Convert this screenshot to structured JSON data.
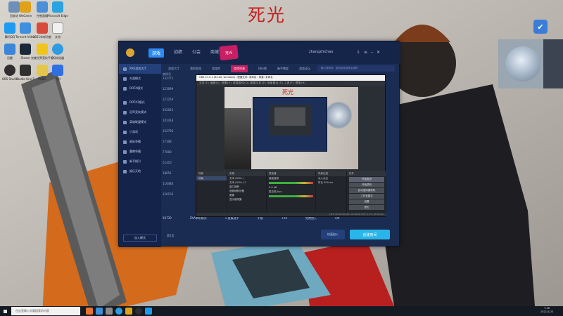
{
  "title": "死光",
  "desktop_icons": [
    {
      "label": "回收站",
      "color": "#6e8fb8"
    },
    {
      "label": "WeGame",
      "color": "#e0a11b"
    },
    {
      "label": "控制面板",
      "color": "#4a90d9"
    },
    {
      "label": "Microsoft Edge",
      "color": "#2aa3e0"
    },
    {
      "label": "腾讯QQ",
      "color": "#1e9bf0"
    },
    {
      "label": "Tencent Video",
      "color": "#3f8fe0"
    },
    {
      "label": "2021年新功能",
      "color": "#d94a3a"
    },
    {
      "label": "文档",
      "color": "#f0f0f0"
    },
    {
      "label": "迅雷",
      "color": "#3a86d8"
    },
    {
      "label": "Steam",
      "color": "#1b2838"
    },
    {
      "label": "完美世界竞技平台",
      "color": "#f0c419"
    },
    {
      "label": "QQ浏览器",
      "color": "#2f9be0"
    },
    {
      "label": "OBS Studio",
      "color": "#302e31"
    },
    {
      "label": "Studio One 5",
      "color": "#303030"
    },
    {
      "label": "PUBG",
      "color": "#e4c74a"
    },
    {
      "label": "飞书",
      "color": "#2f6fdf"
    }
  ],
  "app": {
    "nav": [
      "游戏",
      "战绩",
      "公会",
      "商城"
    ],
    "active_nav": "游戏",
    "badge": "死光",
    "username": "zhangzhichao",
    "tabs": [
      "游戏大厅",
      "我的游戏",
      "游戏库",
      "游戏列表",
      "排行榜",
      "新手教程",
      "游戏论坛"
    ],
    "active_tab": "游戏列表",
    "search_placeholder": "输入房间号，游戏名称或房主昵称",
    "sidebar": [
      "RPG游戏大厅",
      "对战模式",
      "DOTA模式",
      "DOTA2模式",
      "冠军竞技模式",
      "英雄联盟模式",
      "小游戏",
      "星际争霸",
      "魔兽争霸",
      "新手指引",
      "娱乐天地"
    ],
    "sidebar_bottom": "加入模式",
    "list_header": "房间号",
    "room_ids": [
      "132771",
      "123099",
      "121250",
      "102015",
      "101418",
      "152795",
      "57308",
      "77600",
      "51410",
      "18651",
      "116480",
      "126156"
    ],
    "last_row": [
      "20730",
      "ZhA单机模式",
      "1 星级选手",
      "不限",
      "+29",
      "免费加入",
      "4/6"
    ],
    "pager": "第1页",
    "btn_join": "快速加入",
    "btn_create": "创建房间"
  },
  "obs": {
    "window_title": "OBS 27.0.1 (64-bit, windows) - 配置文件: 未命名 - 场景: 未命名",
    "menu": [
      "文件(F)",
      "编辑(E)",
      "视图(V)",
      "停靠部件(D)",
      "配置文件(P)",
      "场景集合(S)",
      "工具(T)",
      "帮助(H)"
    ],
    "docks": {
      "scenes": {
        "title": "场景",
        "items": [
          "场景"
        ]
      },
      "sources": {
        "title": "来源",
        "items": [
          "文本 (GDI+)",
          "文本 (GDI+) 2",
          "窗口捕获",
          "视频捕获设备",
          "图像",
          "显示器采集"
        ]
      },
      "mixer": {
        "title": "混音器",
        "items": [
          "桌面音频",
          "麦克风/Aux"
        ],
        "level": "0.0 dB"
      },
      "transitions": {
        "title": "场景过渡",
        "type": "淡入淡出",
        "duration_label": "时长",
        "duration": "300 ms"
      },
      "controls": {
        "title": "控件",
        "buttons": [
          "开始推流",
          "开始录制",
          "启动虚拟摄像机",
          "工作室模式",
          "设置",
          "退出"
        ]
      }
    },
    "status": "LIVE: 00:00:00  REC: 00:00:00  CPU: 2.5%, 60.00 fps"
  },
  "taskbar": {
    "search_placeholder": "在这里输入你要搜索的内容",
    "time": "7:46",
    "date": "2021/12/3"
  }
}
